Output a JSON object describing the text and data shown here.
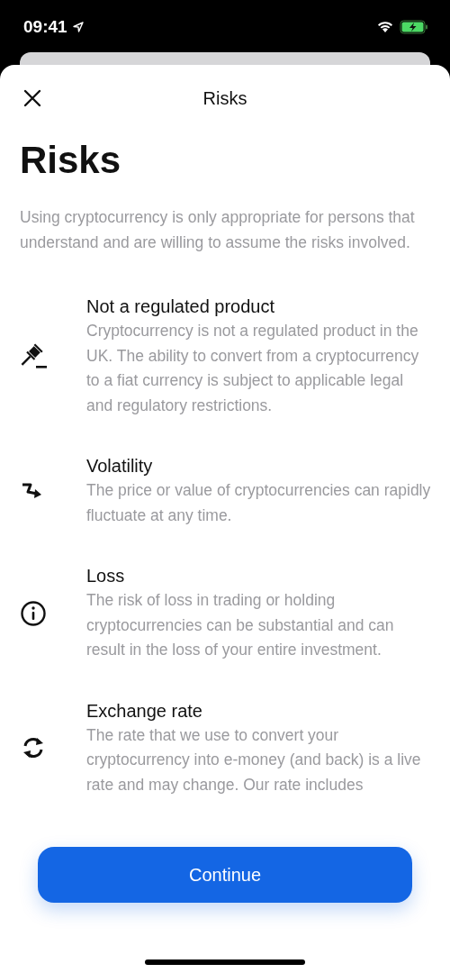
{
  "status_bar": {
    "time": "09:41"
  },
  "nav": {
    "title": "Risks"
  },
  "heading": "Risks",
  "intro": "Using cryptocurrency is only appropriate for persons that understand and are willing to assume the risks involved.",
  "risks": [
    {
      "kind": "gavel",
      "title": "Not a regulated product",
      "body": "Cryptocurrency is not a regulated product in the UK. The ability to convert from a cryptocurrency to a fiat currency is subject to applicable legal and regulatory restrictions."
    },
    {
      "kind": "trend",
      "title": "Volatility",
      "body": "The price or value of cryptocurrencies can rapidly fluctuate at any time."
    },
    {
      "kind": "info",
      "title": "Loss",
      "body": "The risk of loss in trading or holding cryptocurrencies can be substantial and can result in the loss of your entire investment."
    },
    {
      "kind": "exchange",
      "title": "Exchange rate",
      "body": "The rate that we use to convert your cryptocurrency into e-money (and back) is a live rate and may change. Our rate includes"
    }
  ],
  "continue_button": "Continue"
}
